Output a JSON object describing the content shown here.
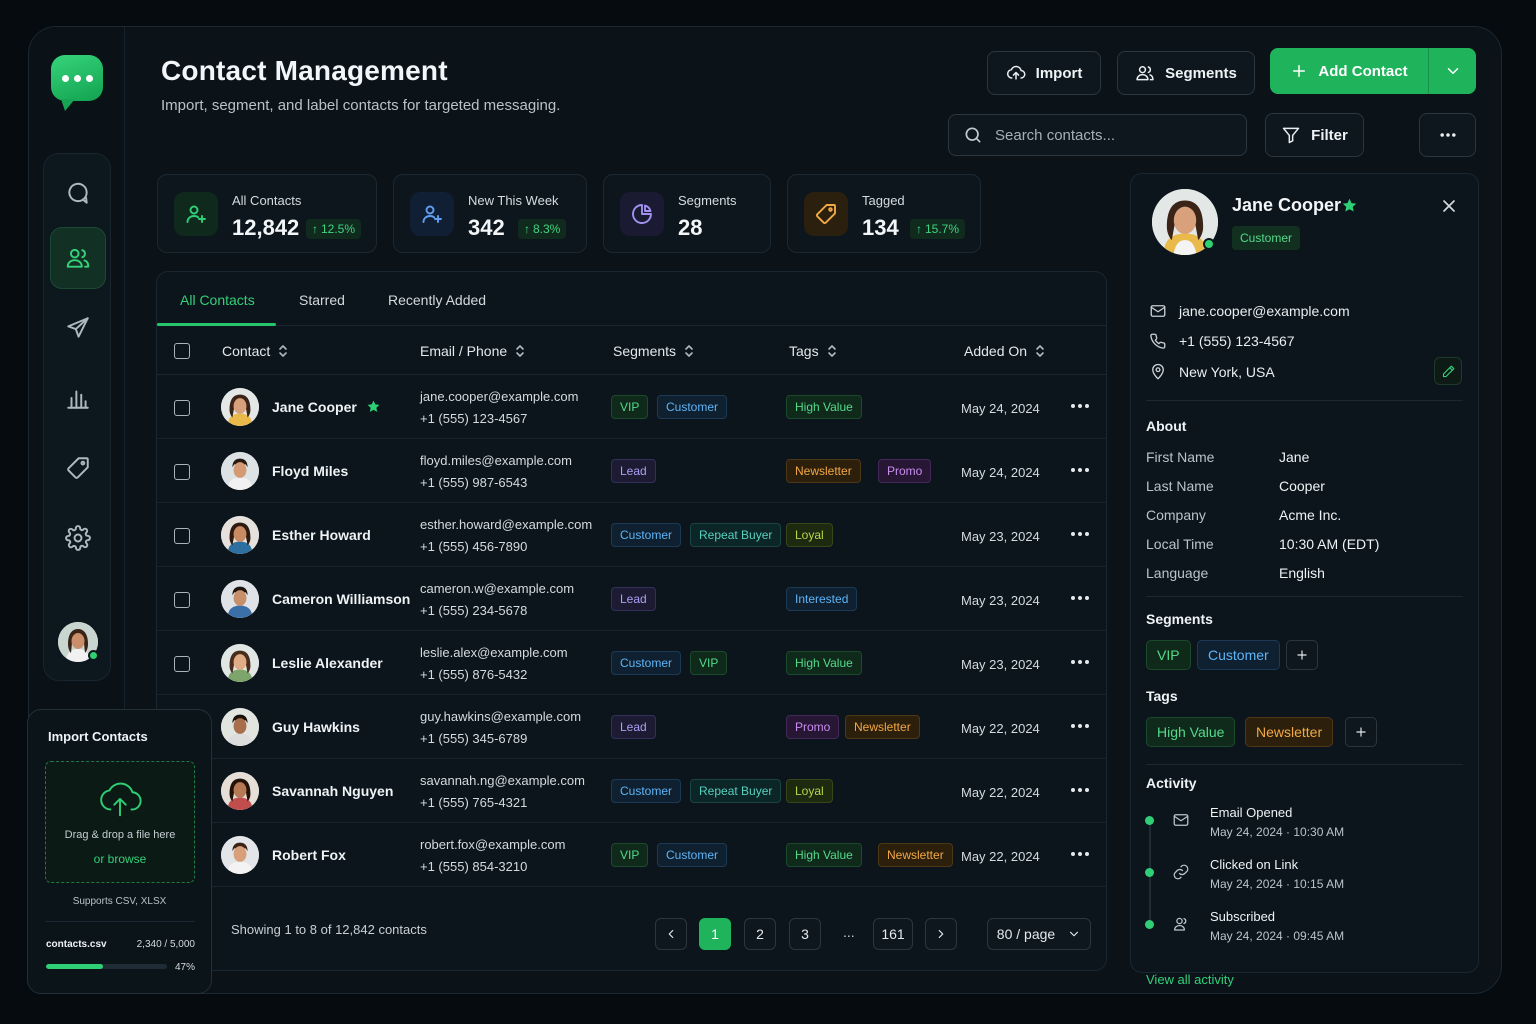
{
  "app": {
    "title": "Contact Management",
    "subtitle": "Import, segment, and label contacts for targeted messaging.",
    "accent": "#1fb45c"
  },
  "nav": {
    "items": [
      {
        "icon": "chat-icon",
        "label": "Conversations"
      },
      {
        "icon": "contacts-icon",
        "label": "Contacts",
        "active": true
      },
      {
        "icon": "send-icon",
        "label": "Campaigns"
      },
      {
        "icon": "analytics-icon",
        "label": "Analytics"
      },
      {
        "icon": "tag-icon",
        "label": "Tags"
      },
      {
        "icon": "settings-icon",
        "label": "Settings"
      }
    ]
  },
  "toolbar": {
    "import_label": "Import",
    "segments_label": "Segments",
    "add_label": "Add Contact",
    "filter_label": "Filter",
    "search_placeholder": "Search contacts..."
  },
  "stats": [
    {
      "label": "All Contacts",
      "value": "12,842",
      "delta": "12.5%",
      "icon": "user-plus-icon",
      "color": "#2fcf75"
    },
    {
      "label": "New This Week",
      "value": "342",
      "delta": "8.3%",
      "icon": "user-add-icon",
      "color": "#5e9ff2"
    },
    {
      "label": "Segments",
      "value": "28",
      "delta": "",
      "icon": "pie-chart-icon",
      "color": "#a291f2"
    },
    {
      "label": "Tagged",
      "value": "134",
      "delta": "15.7%",
      "icon": "tag-icon",
      "color": "#f2a944"
    }
  ],
  "tabs": [
    "All Contacts",
    "Starred",
    "Recently Added"
  ],
  "columns": {
    "contact": "Contact",
    "email_phone": "Email / Phone",
    "segments": "Segments",
    "tags": "Tags",
    "added_on": "Added On"
  },
  "contacts": [
    {
      "name": "Jane Cooper",
      "starred": true,
      "email": "jane.cooper@example.com",
      "phone": "+1 (555) 123-4567",
      "segments": [
        "VIP",
        "Customer"
      ],
      "tags": [
        "High Value"
      ],
      "added": "May 24, 2024",
      "avatar": "f1"
    },
    {
      "name": "Floyd Miles",
      "starred": false,
      "email": "floyd.miles@example.com",
      "phone": "+1 (555) 987-6543",
      "segments": [
        "Lead"
      ],
      "tags": [
        "Newsletter",
        "Promo"
      ],
      "added": "May 24, 2024",
      "avatar": "m1"
    },
    {
      "name": "Esther Howard",
      "starred": false,
      "email": "esther.howard@example.com",
      "phone": "+1 (555) 456-7890",
      "segments": [
        "Customer",
        "Repeat Buyer"
      ],
      "tags": [
        "Loyal"
      ],
      "added": "May 23, 2024",
      "avatar": "f2"
    },
    {
      "name": "Cameron Williamson",
      "starred": false,
      "email": "cameron.w@example.com",
      "phone": "+1 (555) 234-5678",
      "segments": [
        "Lead"
      ],
      "tags": [
        "Interested"
      ],
      "added": "May 23, 2024",
      "avatar": "m2"
    },
    {
      "name": "Leslie Alexander",
      "starred": false,
      "email": "leslie.alex@example.com",
      "phone": "+1 (555) 876-5432",
      "segments": [
        "Customer",
        "VIP"
      ],
      "tags": [
        "High Value"
      ],
      "added": "May 23, 2024",
      "avatar": "f3"
    },
    {
      "name": "Guy Hawkins",
      "starred": false,
      "email": "guy.hawkins@example.com",
      "phone": "+1 (555) 345-6789",
      "segments": [
        "Lead"
      ],
      "tags": [
        "Promo",
        "Newsletter"
      ],
      "added": "May 22, 2024",
      "avatar": "m3"
    },
    {
      "name": "Savannah Nguyen",
      "starred": false,
      "email": "savannah.ng@example.com",
      "phone": "+1 (555) 765-4321",
      "segments": [
        "Customer",
        "Repeat Buyer"
      ],
      "tags": [
        "Loyal"
      ],
      "added": "May 22, 2024",
      "avatar": "f4"
    },
    {
      "name": "Robert Fox",
      "starred": false,
      "email": "robert.fox@example.com",
      "phone": "+1 (555) 854-3210",
      "segments": [
        "VIP",
        "Customer"
      ],
      "tags": [
        "High Value",
        "Newsletter"
      ],
      "added": "May 22, 2024",
      "avatar": "m4"
    }
  ],
  "pagination": {
    "summary": "Showing 1 to 8 of 12,842 contacts",
    "pages": [
      "1",
      "2",
      "3"
    ],
    "ellipsis": "...",
    "last": "161",
    "per_page": "80 / page"
  },
  "import_card": {
    "title": "Import Contacts",
    "drop_text": "Drag & drop a file here",
    "browse_text": "or browse",
    "supports": "Supports CSV, XLSX",
    "file_name": "contacts.csv",
    "file_count": "2,340 / 5,000",
    "progress_label": "47%",
    "progress": 0.47
  },
  "detail": {
    "name": "Jane Cooper",
    "badge": "Customer",
    "email": "jane.cooper@example.com",
    "phone": "+1 (555) 123-4567",
    "location": "New York, USA",
    "about_title": "About",
    "about": [
      {
        "k": "First Name",
        "v": "Jane"
      },
      {
        "k": "Last Name",
        "v": "Cooper"
      },
      {
        "k": "Company",
        "v": "Acme Inc."
      },
      {
        "k": "Local Time",
        "v": "10:30 AM (EDT)"
      },
      {
        "k": "Language",
        "v": "English"
      }
    ],
    "segments_title": "Segments",
    "segments": [
      "VIP",
      "Customer"
    ],
    "tags_title": "Tags",
    "tags": [
      "High Value",
      "Newsletter"
    ],
    "activity_title": "Activity",
    "activity": [
      {
        "title": "Email Opened",
        "date": "May 24, 2024 · 10:30 AM",
        "icon": "mail-icon"
      },
      {
        "title": "Clicked on Link",
        "date": "May 24, 2024 · 10:15 AM",
        "icon": "link-icon"
      },
      {
        "title": "Subscribed",
        "date": "May 24, 2024 · 09:45 AM",
        "icon": "user-check-icon"
      }
    ],
    "view_all": "View all activity"
  }
}
